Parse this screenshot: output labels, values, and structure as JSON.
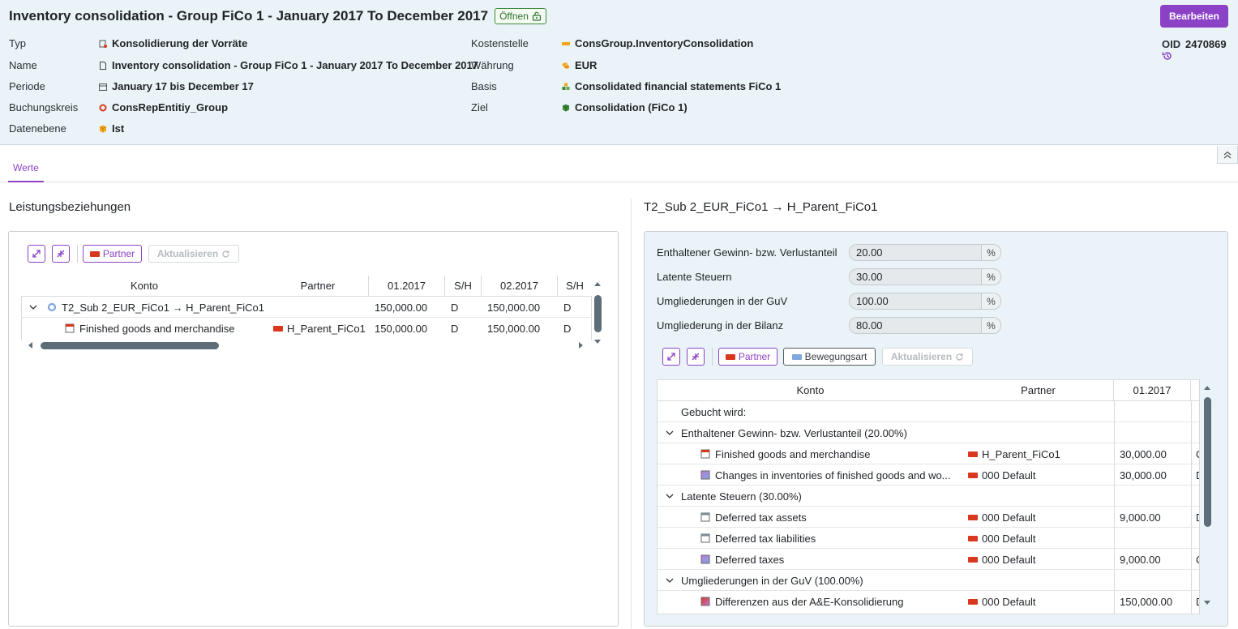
{
  "header": {
    "title": "Inventory consolidation - Group FiCo 1 - January 2017 To December 2017",
    "status": "Öffnen",
    "edit_label": "Bearbeiten",
    "oid_label": "OID",
    "oid_value": "2470869",
    "fields_left": [
      {
        "label": "Typ",
        "value": "Konsolidierung der Vorräte",
        "icon": "document-stack-icon"
      },
      {
        "label": "Name",
        "value": "Inventory consolidation - Group FiCo 1 - January 2017 To December 2017",
        "icon": "document-icon"
      },
      {
        "label": "Periode",
        "value": "January 17 bis December 17",
        "icon": "calendar-icon"
      },
      {
        "label": "Buchungskreis",
        "value": "ConsRepEntitiy_Group",
        "icon": "ring-icon"
      },
      {
        "label": "Datenebene",
        "value": "Ist",
        "icon": "cube-icon"
      }
    ],
    "fields_right": [
      {
        "label": "Kostenstelle",
        "value": "ConsGroup.InventoryConsolidation",
        "icon": "bar-icon"
      },
      {
        "label": "Währung",
        "value": "EUR",
        "icon": "coins-icon"
      },
      {
        "label": "Basis",
        "value": "Consolidated financial statements FiCo 1",
        "icon": "cubes-icon"
      },
      {
        "label": "Ziel",
        "value": "Consolidation (FiCo 1)",
        "icon": "cube-green-icon"
      }
    ]
  },
  "colors": {
    "accent": "#8b42c6",
    "header_bg": "#eaf3f7",
    "flag_red": "#d9381e"
  },
  "tabs": [
    {
      "label": "Werte"
    }
  ],
  "left": {
    "title": "Leistungsbeziehungen",
    "toolbar": {
      "partner": "Partner",
      "refresh": "Aktualisieren"
    },
    "columns": [
      "Konto",
      "Partner",
      "01.2017",
      "S/H",
      "02.2017",
      "S/H"
    ],
    "rows": [
      {
        "konto": "T2_Sub 2_EUR_FiCo1 → H_Parent_FiCo1",
        "partner": "",
        "v1": "150,000.00",
        "sh1": "D",
        "v2": "150,000.00",
        "sh2": "D"
      },
      {
        "konto": "Finished goods and merchandise",
        "partner": "H_Parent_FiCo1",
        "v1": "150,000.00",
        "sh1": "D",
        "v2": "150,000.00",
        "sh2": "D"
      }
    ]
  },
  "right": {
    "title": "T2_Sub 2_EUR_FiCo1 → H_Parent_FiCo1",
    "params": [
      {
        "label": "Enthaltener Gewinn- bzw. Verlustanteil",
        "value": "20.00",
        "unit": "%"
      },
      {
        "label": "Latente Steuern",
        "value": "30.00",
        "unit": "%"
      },
      {
        "label": "Umgliederungen in der GuV",
        "value": "100.00",
        "unit": "%"
      },
      {
        "label": "Umgliederung in der Bilanz",
        "value": "80.00",
        "unit": "%"
      }
    ],
    "toolbar": {
      "partner": "Partner",
      "movement": "Bewegungsart",
      "refresh": "Aktualisieren"
    },
    "columns": [
      "Konto",
      "Partner",
      "01.2017"
    ],
    "rows": [
      {
        "type": "text",
        "konto": "Gebucht wird:"
      },
      {
        "type": "group",
        "konto": "Enthaltener Gewinn- bzw. Verlustanteil (20.00%)"
      },
      {
        "type": "item",
        "icon": "red",
        "konto": "Finished goods and merchandise",
        "partner": "H_Parent_FiCo1",
        "v1": "30,000.00",
        "sh": "C"
      },
      {
        "type": "item",
        "icon": "gradient",
        "konto": "Changes in inventories of finished goods and wo...",
        "partner": "000 Default",
        "v1": "30,000.00",
        "sh": "D"
      },
      {
        "type": "group",
        "konto": "Latente Steuern (30.00%)"
      },
      {
        "type": "item",
        "icon": "grey",
        "konto": "Deferred tax assets",
        "partner": "000 Default",
        "v1": "9,000.00",
        "sh": "D"
      },
      {
        "type": "item",
        "icon": "grey",
        "konto": "Deferred tax liabilities",
        "partner": "000 Default",
        "v1": "",
        "sh": ""
      },
      {
        "type": "item",
        "icon": "gradient",
        "konto": "Deferred taxes",
        "partner": "000 Default",
        "v1": "9,000.00",
        "sh": "C"
      },
      {
        "type": "group",
        "konto": "Umgliederungen in der GuV (100.00%)"
      },
      {
        "type": "item",
        "icon": "gradient2",
        "konto": "Differenzen aus der A&E-Konsolidierung",
        "partner": "000 Default",
        "v1": "150,000.00",
        "sh": "D"
      }
    ]
  }
}
